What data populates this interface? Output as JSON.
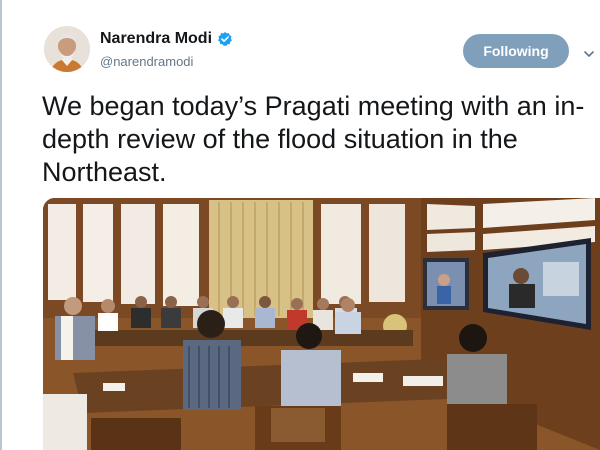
{
  "tweet": {
    "author_name": "Narendra Modi",
    "author_handle": "@narendramodi",
    "follow_label": "Following",
    "text": "We began today’s Pragati meeting with an in-depth review of the flood situation in the Northeast."
  },
  "icons": {
    "verified": "verified-badge-icon",
    "more": "chevron-down-icon"
  },
  "colors": {
    "follow_button": "#7f9fbb",
    "verified_badge": "#1da1f2",
    "handle_text": "#657786"
  }
}
